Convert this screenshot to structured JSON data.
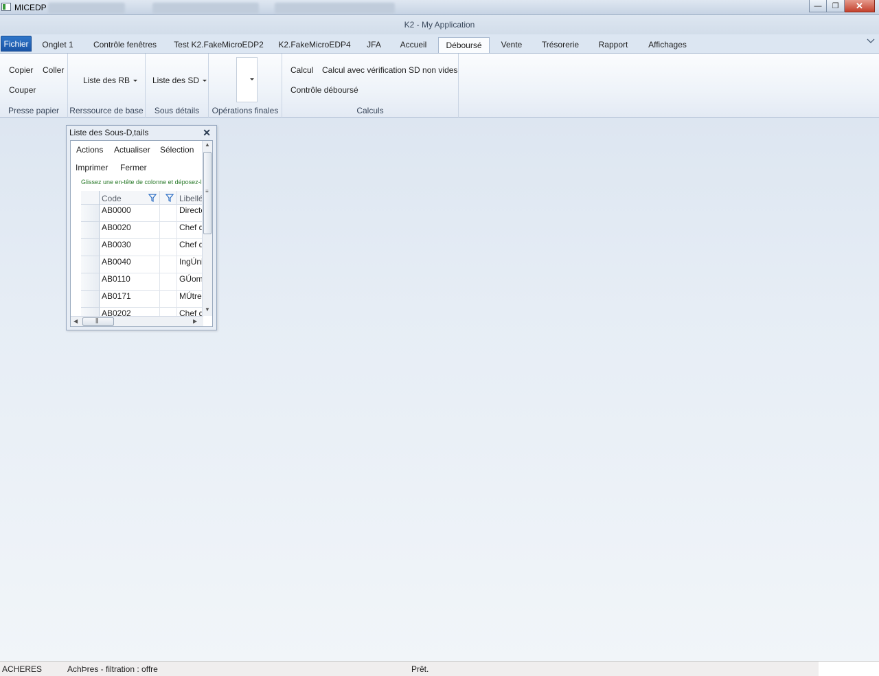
{
  "os_window": {
    "app_name": "MICEDP",
    "min_icon": "minimize-icon",
    "max_icon": "restore-icon",
    "close_icon": "close-icon"
  },
  "app": {
    "title": "K2 - My Application"
  },
  "tabs": [
    {
      "label": "Fichier"
    },
    {
      "label": "Onglet 1"
    },
    {
      "label": "Contrôle fenêtres"
    },
    {
      "label": "Test K2.FakeMicroEDP2"
    },
    {
      "label": "K2.FakeMicroEDP4"
    },
    {
      "label": "JFA"
    },
    {
      "label": "Accueil"
    },
    {
      "label": "Déboursé"
    },
    {
      "label": "Vente"
    },
    {
      "label": "Trésorerie"
    },
    {
      "label": "Rapport"
    },
    {
      "label": "Affichages"
    }
  ],
  "ribbon": {
    "clipboard": {
      "copy": "Copier",
      "paste": "Coller",
      "cut": "Couper",
      "label": "Presse papier"
    },
    "base_resource": {
      "button": "Liste des RB",
      "label": "Rerssource de base"
    },
    "sub_details": {
      "button": "Liste des SD",
      "label": "Sous détails"
    },
    "final_ops": {
      "label": "Opérations finales"
    },
    "calcs": {
      "calc": "Calcul",
      "calc_check": "Calcul avec vérification SD non vides",
      "control": "Contrôle déboursé",
      "label": "Calculs"
    }
  },
  "panel": {
    "title": "Liste des Sous-D‚tails",
    "menu": {
      "actions": "Actions",
      "refresh": "Actualiser",
      "selection": "Sélection",
      "print": "Imprimer",
      "close": "Fermer"
    },
    "group_hint": "Glissez une en-tête de colonne et déposez-la ici pour grouper par cette colonne",
    "columns": [
      "Code",
      "",
      "Libellé"
    ],
    "rows": [
      {
        "code": "AB0000",
        "label": "Directeur"
      },
      {
        "code": "AB0020",
        "label": "Chef de chantier"
      },
      {
        "code": "AB0030",
        "label": "Chef d'équipe"
      },
      {
        "code": "AB0040",
        "label": "IngÚnieur"
      },
      {
        "code": "AB0110",
        "label": "GÚomètre"
      },
      {
        "code": "AB0171",
        "label": "MÚtreur"
      },
      {
        "code": "AB0202",
        "label": "Chef de poste"
      }
    ]
  },
  "status": {
    "site": "ACHERES",
    "filter": "AchÞres - filtration : offre",
    "state": "Prêt."
  }
}
